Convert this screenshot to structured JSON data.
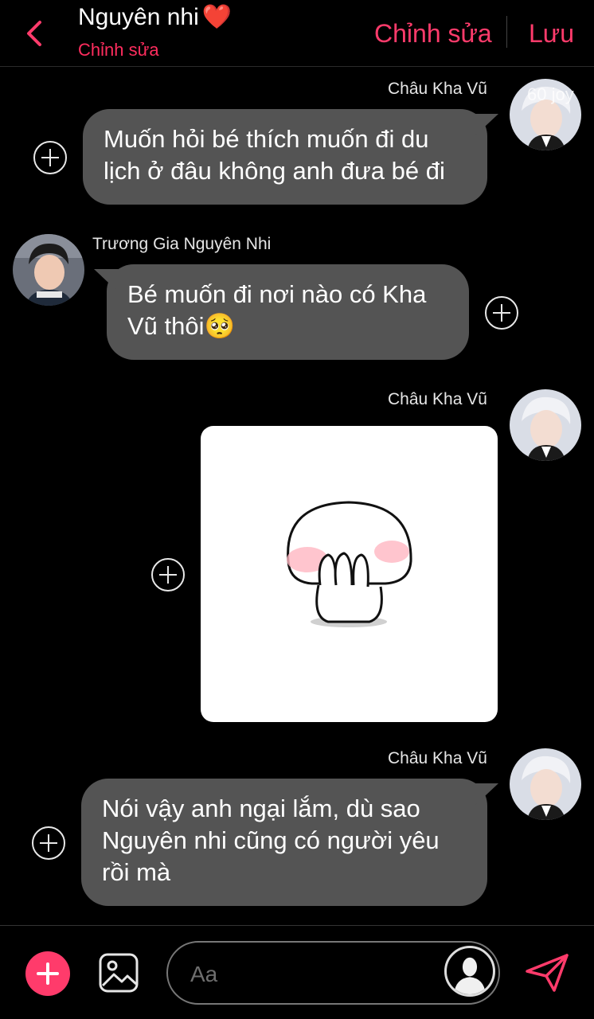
{
  "header": {
    "title": "Nguyên nhi",
    "heart": "❤️",
    "subtitle": "Chỉnh sửa",
    "edit_label": "Chỉnh sửa",
    "save_label": "Lưu"
  },
  "watermark": "60 joy",
  "messages": [
    {
      "sender": "Châu Kha Vũ",
      "side": "right",
      "text": "Muốn hỏi bé thích muốn đi du lịch ở đâu không anh đưa bé đi"
    },
    {
      "sender": "Trương Gia Nguyên Nhi",
      "side": "left",
      "text": "Bé muốn đi nơi nào có Kha Vũ thôi🥺"
    },
    {
      "sender": "Châu Kha Vũ",
      "side": "right",
      "type": "sticker"
    },
    {
      "sender": "Châu Kha Vũ",
      "side": "right",
      "text": "Nói vậy anh ngại lắm, dù sao Nguyên nhi cũng có người yêu rồi mà"
    }
  ],
  "composer": {
    "placeholder": "Aa"
  },
  "colors": {
    "accent": "#ff3b6b",
    "bubble": "#545454",
    "background": "#000000"
  }
}
